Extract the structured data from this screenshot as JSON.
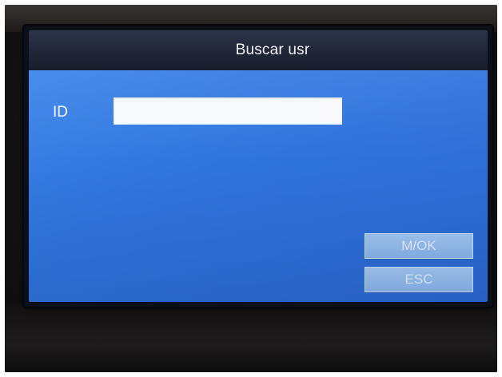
{
  "window": {
    "title": "Buscar usr"
  },
  "form": {
    "id_label": "ID",
    "id_value": ""
  },
  "buttons": {
    "ok_label": "M/OK",
    "esc_label": "ESC"
  },
  "colors": {
    "title_bar": "#1f2637",
    "body_background": "#2f73dc",
    "button_fill": "#8fb8ec",
    "button_text": "#d9e8fb",
    "input_background": "#f7f9fd"
  }
}
